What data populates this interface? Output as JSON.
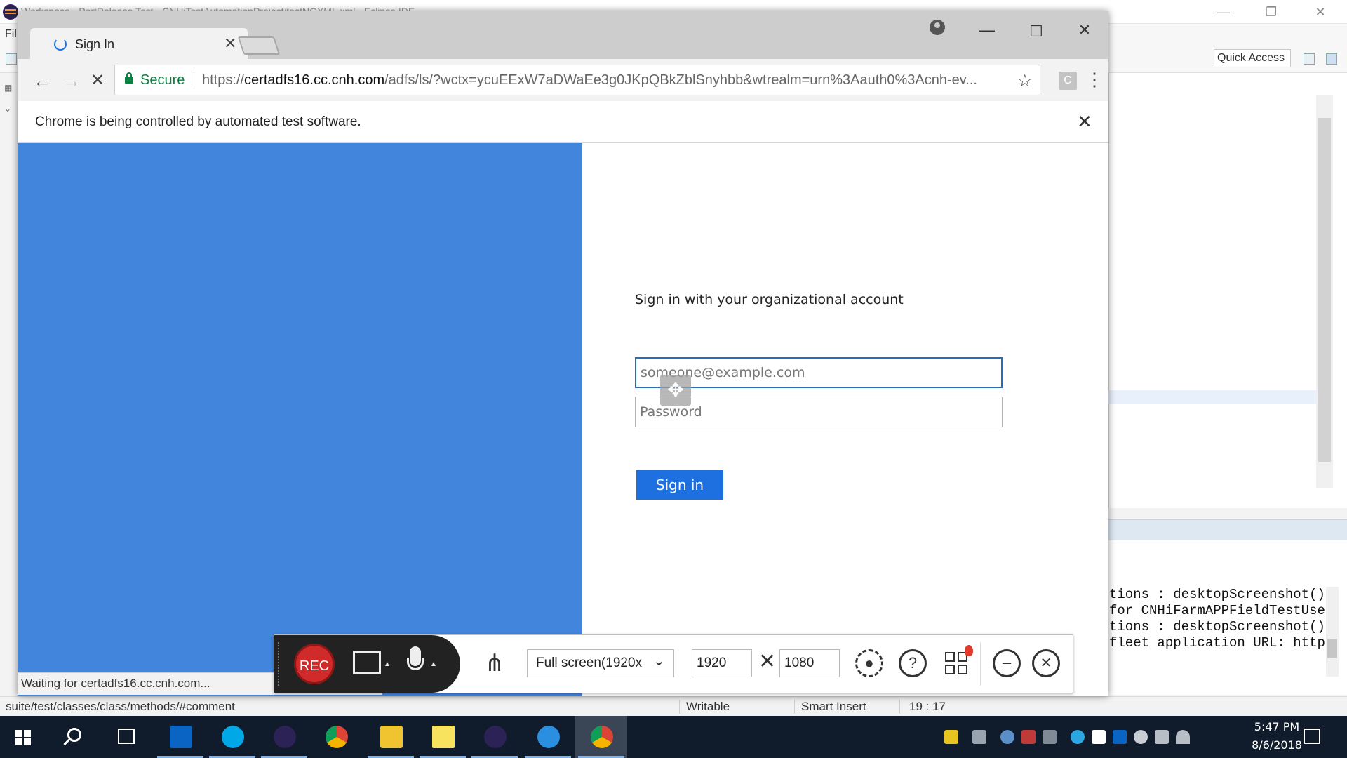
{
  "eclipse": {
    "title": "Workspace - PortRelease Test - CNHiTestAutomationProject/testNGXML.xml - Eclipse IDE",
    "menu_file": "Fil",
    "quick_access": "Quick Access",
    "console_lines": [
      "tions : desktopScreenshot()]",
      "for CNHiFarmAPPFieldTestUser",
      "tions : desktopScreenshot()]",
      "fleet application URL: http:"
    ],
    "status": {
      "path": "suite/test/classes/class/methods/#comment",
      "mode": "Writable",
      "insert": "Smart Insert",
      "position": "19 : 17"
    }
  },
  "chrome": {
    "tab_title": "Sign In",
    "secure_label": "Secure",
    "url_prefix": "https://",
    "url_host": "certadfs16.cc.cnh.com",
    "url_rest": "/adfs/ls/?wctx=ycuEExW7aDWaEe3g0JKpQBkZblSnyhbb&wtrealm=urn%3Aauth0%3Acnh-ev...",
    "extension_label": "C",
    "infobar_text": "Chrome is being controlled by automated test software.",
    "status_text": "Waiting for certadfs16.cc.cnh.com..."
  },
  "signin": {
    "heading": "Sign in with your organizational account",
    "username_placeholder": "someone@example.com",
    "password_placeholder": "Password",
    "button_label": "Sign in"
  },
  "recorder": {
    "rec_label": "REC",
    "mode_label": "Full screen(1920x",
    "width": "1920",
    "height": "1080"
  },
  "taskbar": {
    "time": "5:47 PM",
    "date": "8/6/2018"
  },
  "colors": {
    "brand_blue": "#4285dd",
    "signin_button": "#1e6fe0",
    "secure_green": "#0b8043",
    "rec_red": "#d12a2a",
    "taskbar": "#101c2b"
  }
}
